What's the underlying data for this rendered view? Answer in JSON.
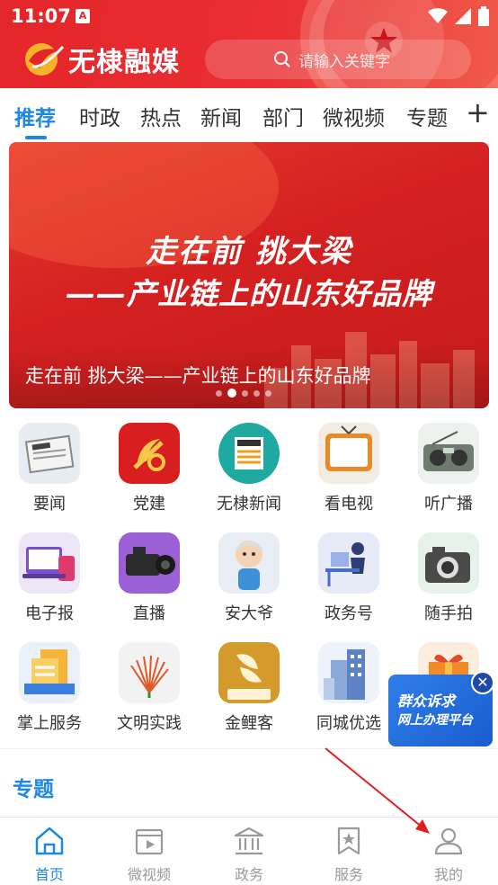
{
  "status_bar": {
    "time": "11:07",
    "notification_glyph": "A"
  },
  "header": {
    "app_name": "无棣融媒",
    "search_placeholder": "请输入关键字",
    "accent_color": "#e4252a"
  },
  "tabs": {
    "items": [
      {
        "label": "推荐",
        "active": true
      },
      {
        "label": "时政",
        "active": false
      },
      {
        "label": "热点",
        "active": false
      },
      {
        "label": "新闻",
        "active": false
      },
      {
        "label": "部门",
        "active": false
      },
      {
        "label": "微视频",
        "active": false
      },
      {
        "label": "专题",
        "active": false
      }
    ],
    "add_label": "+"
  },
  "banner": {
    "headline_line1": "走在前  挑大梁",
    "headline_line2": "——产业链上的山东好品牌",
    "caption": "走在前 挑大梁——产业链上的山东好品牌",
    "slide_count": 5,
    "active_slide": 2
  },
  "services": [
    {
      "label": "要闻",
      "icon": "newspaper-icon"
    },
    {
      "label": "党建",
      "icon": "party-emblem-icon"
    },
    {
      "label": "无棣新闻",
      "icon": "news-badge-icon"
    },
    {
      "label": "看电视",
      "icon": "tv-icon"
    },
    {
      "label": "听广播",
      "icon": "radio-icon"
    },
    {
      "label": "电子报",
      "icon": "devices-icon"
    },
    {
      "label": "直播",
      "icon": "video-camera-icon"
    },
    {
      "label": "安大爷",
      "icon": "grandpa-icon"
    },
    {
      "label": "政务号",
      "icon": "desk-person-icon"
    },
    {
      "label": "随手拍",
      "icon": "camera-icon"
    },
    {
      "label": "掌上服务",
      "icon": "service-docs-icon"
    },
    {
      "label": "文明实践",
      "icon": "fan-icon"
    },
    {
      "label": "金鲤客",
      "icon": "golden-carp-icon"
    },
    {
      "label": "同城优选",
      "icon": "buildings-icon"
    }
  ],
  "floating_ad": {
    "line1": "群众诉求",
    "line2": "网上办理平台",
    "close": "✕"
  },
  "section": {
    "title": "专题"
  },
  "bottom_nav": [
    {
      "label": "首页",
      "icon": "home-icon",
      "active": true
    },
    {
      "label": "微视频",
      "icon": "video-clip-icon",
      "active": false
    },
    {
      "label": "政务",
      "icon": "government-building-icon",
      "active": false
    },
    {
      "label": "服务",
      "icon": "star-bookmark-icon",
      "active": false
    },
    {
      "label": "我的",
      "icon": "person-icon",
      "active": false
    }
  ]
}
